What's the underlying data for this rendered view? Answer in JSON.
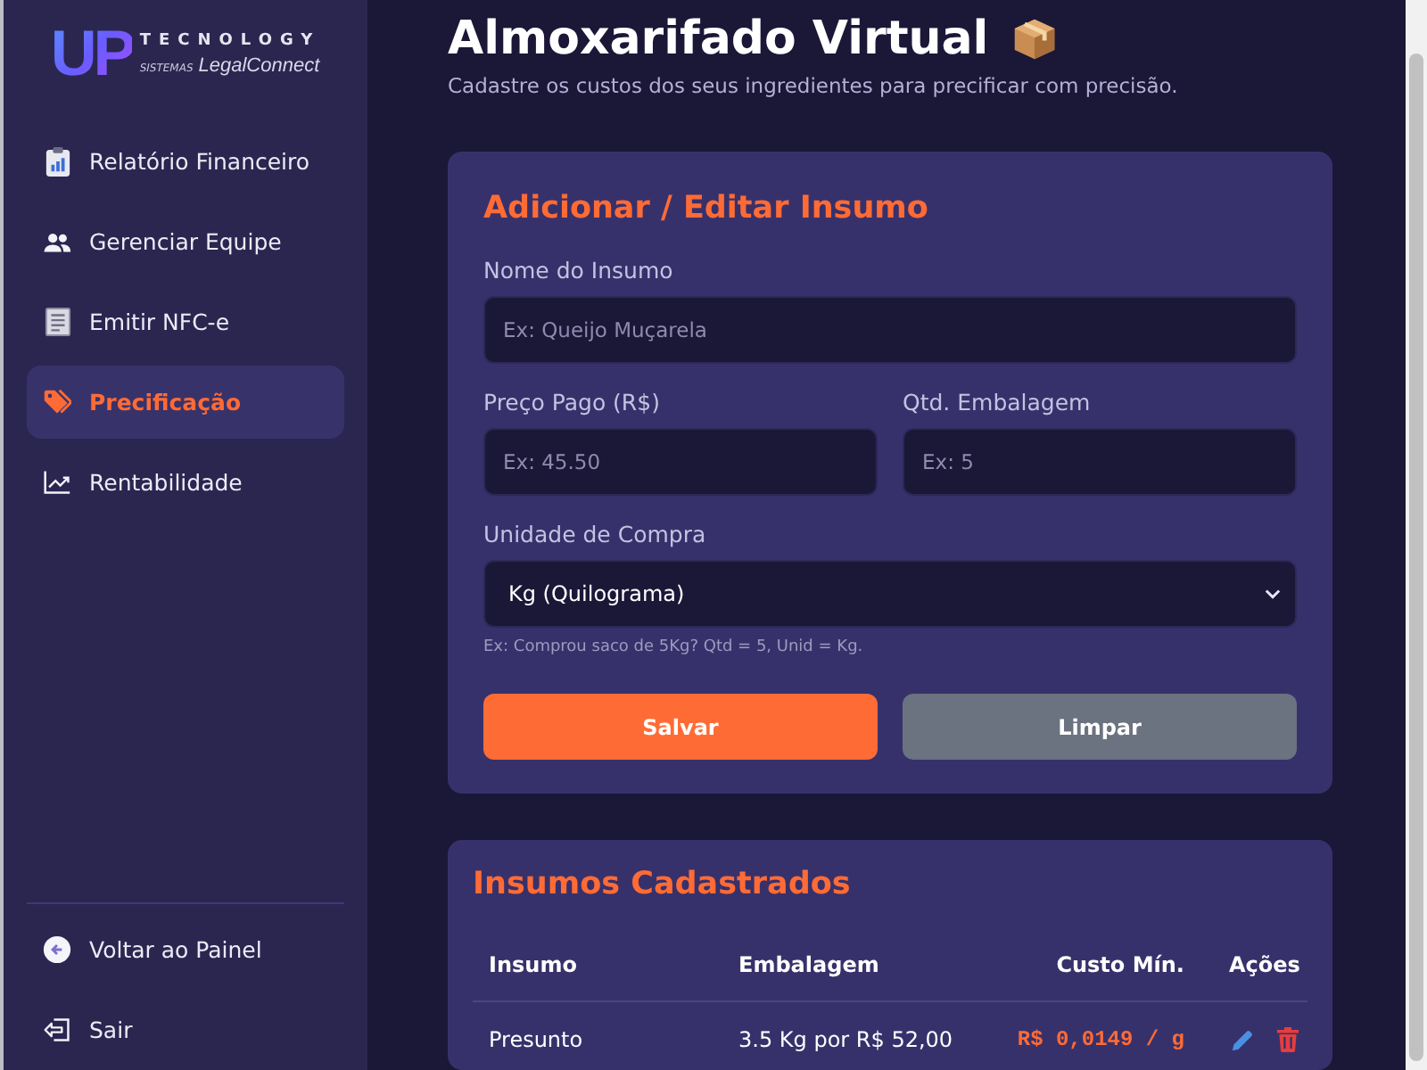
{
  "logo": {
    "mark": "UP",
    "name": "TECNOLOGY",
    "prefix": "SISTEMAS",
    "product": "LegalConnect"
  },
  "sidebar": {
    "items": [
      {
        "label": "Relatório Financeiro",
        "kind": "report",
        "selected": false
      },
      {
        "label": "Gerenciar Equipe",
        "kind": "team",
        "selected": false
      },
      {
        "label": "Emitir NFC-e",
        "kind": "invoice",
        "selected": false
      },
      {
        "label": "Precificação",
        "kind": "pricing",
        "selected": true
      },
      {
        "label": "Rentabilidade",
        "kind": "profit",
        "selected": false
      }
    ],
    "footer_items": [
      {
        "label": "Voltar ao Painel",
        "kind": "back"
      },
      {
        "label": "Sair",
        "kind": "logout"
      }
    ]
  },
  "header": {
    "title": "Almoxarifado Virtual",
    "subtitle": "Cadastre os custos dos seus ingredientes para precificar com precisão."
  },
  "form": {
    "title": "Adicionar / Editar Insumo",
    "rows": [
      [
        {
          "label": "Nome do Insumo",
          "kind": "text",
          "placeholder": "Ex: Queijo Muçarela"
        }
      ],
      [
        {
          "label": "Preço Pago (R$)",
          "kind": "text",
          "placeholder": "Ex: 45.50"
        },
        {
          "label": "Qtd. Embalagem",
          "kind": "text",
          "placeholder": "Ex: 5"
        }
      ],
      [
        {
          "label": "Unidade de Compra",
          "kind": "select",
          "value": "Kg (Quilograma)"
        }
      ]
    ],
    "hint": "Ex: Comprou saco de 5Kg? Qtd = 5, Unid = Kg.",
    "buttons": [
      {
        "label": "Salvar",
        "kind": "primary"
      },
      {
        "label": "Limpar",
        "kind": "secondary"
      }
    ]
  },
  "table": {
    "title": "Insumos Cadastrados",
    "columns": [
      "Insumo",
      "Embalagem",
      "Custo Mín.",
      "Ações"
    ],
    "rows": [
      {
        "cells": [
          "Presunto",
          "3.5 Kg por R$ 52,00",
          "R$ 0,0149 / g"
        ]
      }
    ]
  }
}
